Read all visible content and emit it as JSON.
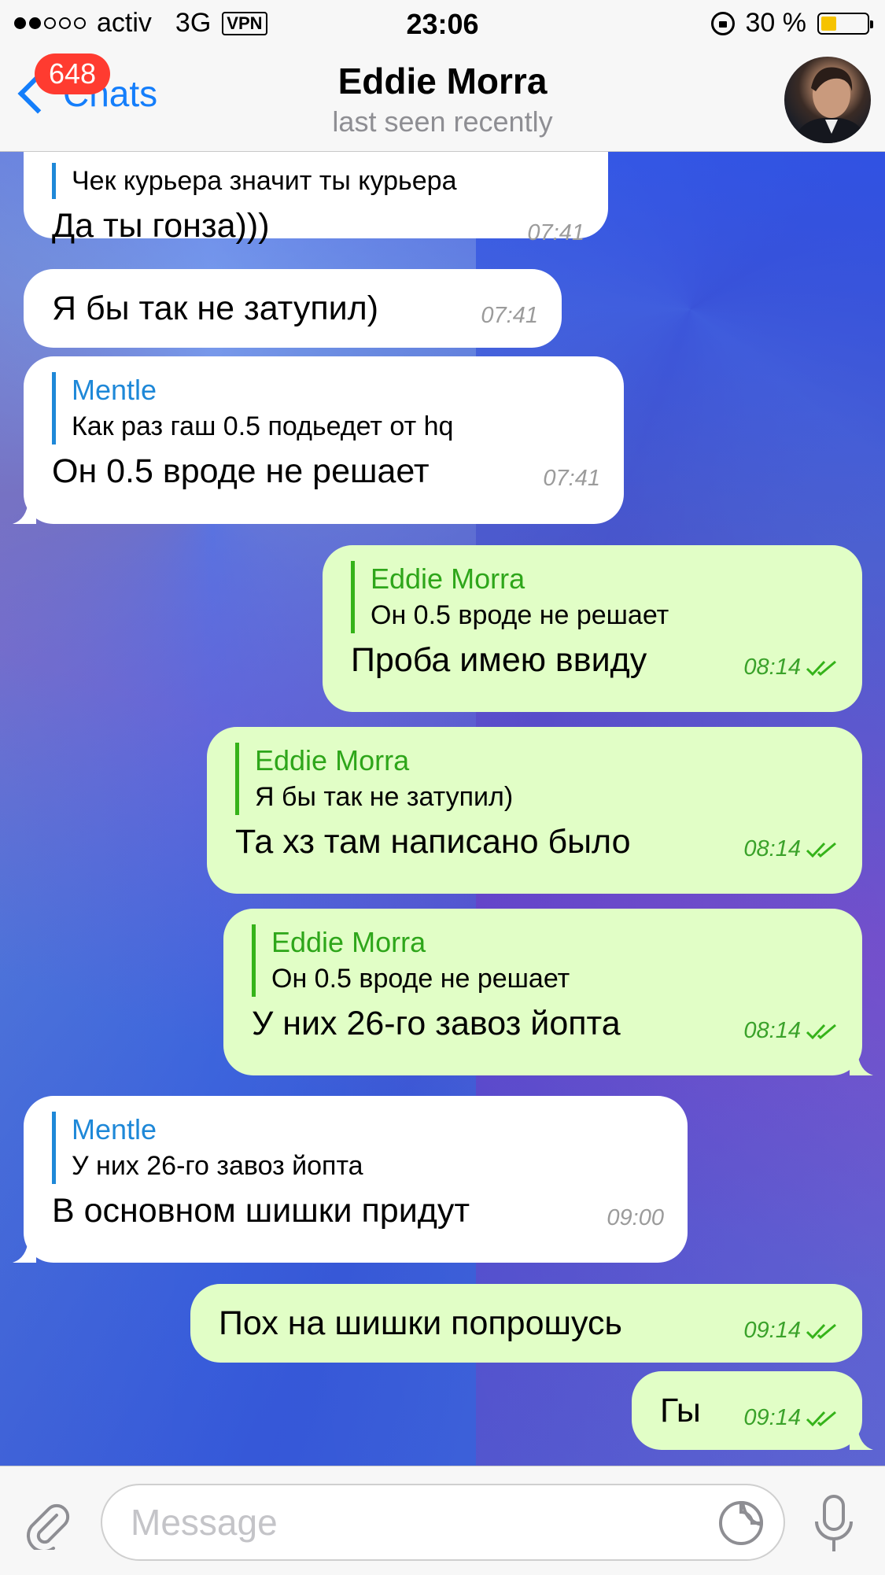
{
  "status_bar": {
    "carrier": "activ",
    "network": "3G",
    "vpn": "VPN",
    "time": "23:06",
    "battery_percent": "30 %",
    "battery_level": 0.3,
    "signal_bars_filled": 2,
    "signal_bars_total": 5
  },
  "nav": {
    "back_label": "Chats",
    "unread_count": "648",
    "title": "Eddie Morra",
    "subtitle": "last seen recently"
  },
  "colors": {
    "accent": "#147efb",
    "incoming_bubble": "#ffffff",
    "outgoing_bubble": "#e1fec6",
    "incoming_reply": "#1e88d8",
    "outgoing_reply": "#2ea61a",
    "badge": "#ff3b30"
  },
  "messages": [
    {
      "direction": "in",
      "reply_name": "",
      "reply_text": "Чек курьера значит ты курьера",
      "text": "Да ты гонза)))",
      "time": "07:41"
    },
    {
      "direction": "in",
      "text": "Я бы так не затупил)",
      "time": "07:41"
    },
    {
      "direction": "in",
      "reply_name": "Mentle",
      "reply_text": "Как раз гаш 0.5 подьедет от hq",
      "text": "Он 0.5 вроде не решает",
      "time": "07:41"
    },
    {
      "direction": "out",
      "reply_name": "Eddie Morra",
      "reply_text": "Он 0.5 вроде не решает",
      "text": "Проба имею ввиду",
      "time": "08:14",
      "read": true
    },
    {
      "direction": "out",
      "reply_name": "Eddie Morra",
      "reply_text": "Я бы так не затупил)",
      "text": "Та хз там написано было",
      "time": "08:14",
      "read": true
    },
    {
      "direction": "out",
      "reply_name": "Eddie Morra",
      "reply_text": "Он 0.5 вроде не решает",
      "text": "У них 26-го завоз йопта",
      "time": "08:14",
      "read": true
    },
    {
      "direction": "in",
      "reply_name": "Mentle",
      "reply_text": "У них 26-го завоз йопта",
      "text": "В основном шишки придут",
      "time": "09:00"
    },
    {
      "direction": "out",
      "text": "Пох на шишки попрошусь",
      "time": "09:14",
      "read": true
    },
    {
      "direction": "out",
      "text": "Гы",
      "time": "09:14",
      "read": true
    }
  ],
  "input": {
    "placeholder": "Message"
  },
  "icons": {
    "back": "chevron-left-icon",
    "attach": "paperclip-icon",
    "sticker": "sticker-icon",
    "mic": "microphone-icon",
    "read": "double-check-icon"
  }
}
